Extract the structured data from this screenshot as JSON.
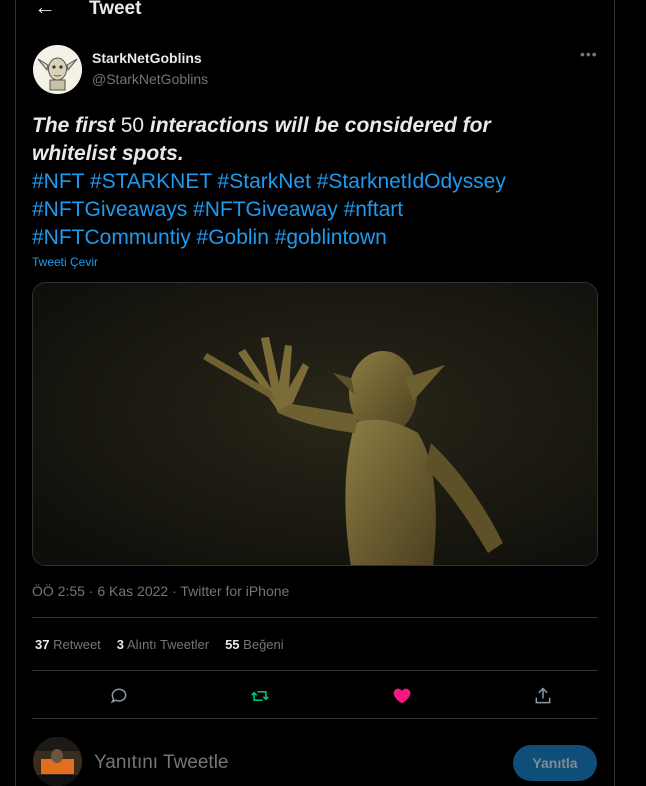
{
  "header": {
    "title": "Tweet",
    "back_icon": "arrow-left-icon"
  },
  "tweet": {
    "author_name": "StarkNetGoblins",
    "author_handle": "@StarkNetGoblins",
    "more_icon": "more-horizontal-icon",
    "text_line1_a": "The first",
    "text_line1_num": "50",
    "text_line1_b": "interactions will be considered for",
    "text_line2": "whitelist spots.",
    "hashtags_line1": "#NFT #STARKNET #StarkNet #StarknetIdOdyssey",
    "hashtags_line2": "#NFTGiveaways #NFTGiveaway #nftart",
    "hashtags_line3": "#NFTCommuntiy #Goblin #goblintown",
    "translate_label": "Tweeti Çevir",
    "timestamp": "ÖÖ 2:55 · 6 Kas 2022 · Twitter for iPhone"
  },
  "stats": {
    "retweets_count": "37",
    "retweets_label": "Retweet",
    "quotes_count": "3",
    "quotes_label": "Alıntı Tweetler",
    "likes_count": "55",
    "likes_label": "Beğeni"
  },
  "actions": [
    "reply-icon",
    "retweet-icon",
    "like-icon",
    "share-icon"
  ],
  "colors": {
    "accent": "#1d9bf0",
    "retweet": "#00ba7c",
    "like": "#f91880",
    "border": "#2f3336"
  },
  "reply": {
    "placeholder": "Yanıtını Tweetle",
    "button_label": "Yanıtla"
  }
}
